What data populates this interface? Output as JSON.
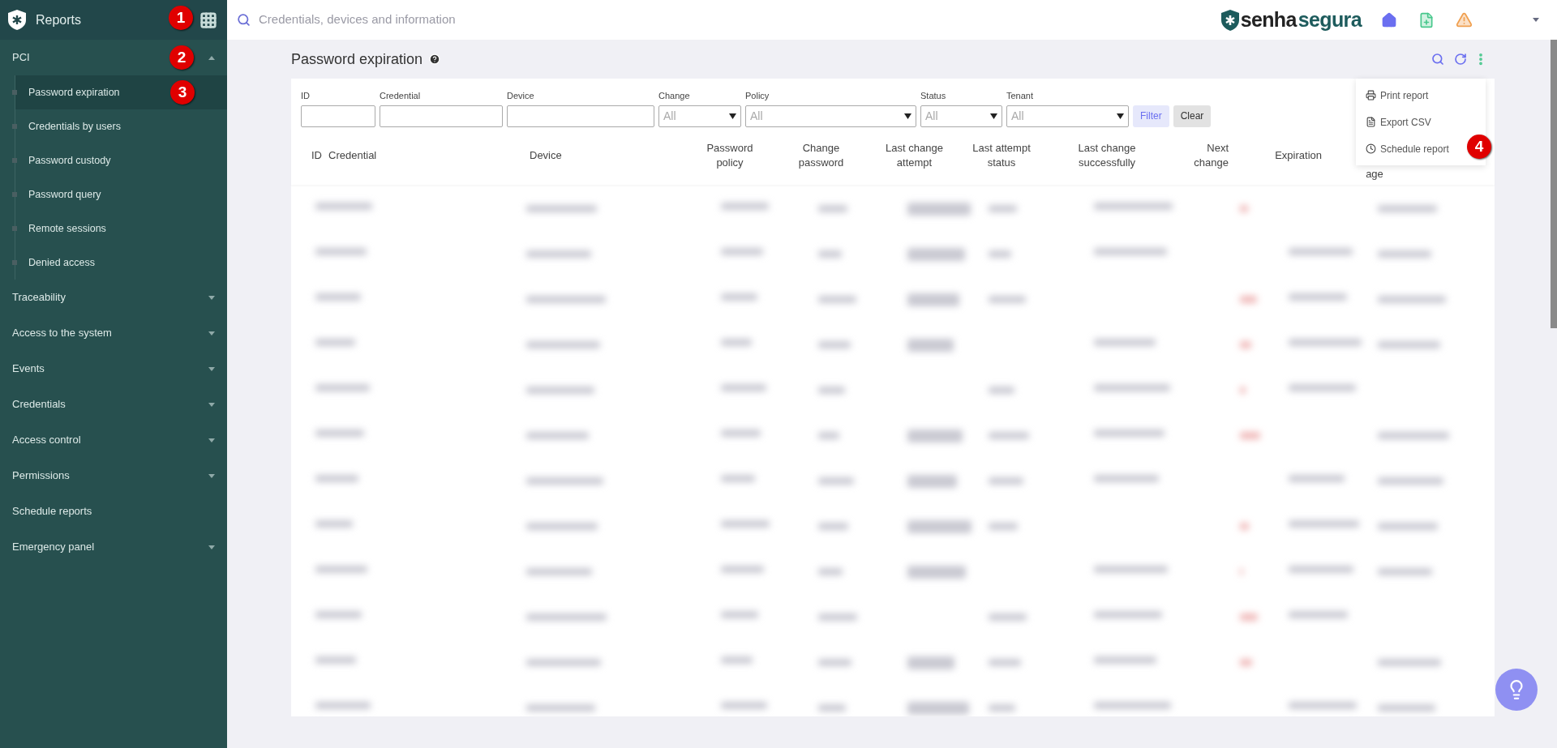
{
  "sidebar": {
    "title": "Reports",
    "callout": "1",
    "sections": [
      {
        "label": "PCI",
        "kind": "group",
        "expanded": true,
        "callout": "2",
        "children": [
          {
            "label": "Password expiration",
            "selected": true,
            "callout": "3"
          },
          {
            "label": "Credentials by users",
            "selected": false
          },
          {
            "label": "Password custody",
            "selected": false
          },
          {
            "label": "Password query",
            "selected": false
          },
          {
            "label": "Remote sessions",
            "selected": false
          },
          {
            "label": "Denied access",
            "selected": false
          }
        ]
      },
      {
        "label": "Traceability",
        "kind": "group",
        "expanded": false
      },
      {
        "label": "Access to the system",
        "kind": "group",
        "expanded": false
      },
      {
        "label": "Events",
        "kind": "group",
        "expanded": false
      },
      {
        "label": "Credentials",
        "kind": "group",
        "expanded": false
      },
      {
        "label": "Access control",
        "kind": "group",
        "expanded": false
      },
      {
        "label": "Permissions",
        "kind": "group",
        "expanded": false
      },
      {
        "label": "Schedule reports",
        "kind": "link"
      },
      {
        "label": "Emergency panel",
        "kind": "group",
        "expanded": false
      }
    ]
  },
  "topbar": {
    "search": {
      "placeholder": "Credentials, devices and information"
    },
    "logo": {
      "part_1": "senha",
      "part_2": "segura"
    }
  },
  "page": {
    "title": "Password expiration"
  },
  "filters": [
    {
      "label": "ID",
      "kind": "text"
    },
    {
      "label": "Credential",
      "kind": "text"
    },
    {
      "label": "Device",
      "kind": "text"
    },
    {
      "label": "Change",
      "kind": "select",
      "value": "All"
    },
    {
      "label": "Policy",
      "kind": "select",
      "value": "All"
    },
    {
      "label": "Status",
      "kind": "select",
      "value": "All"
    },
    {
      "label": "Tenant",
      "kind": "select",
      "value": "All"
    }
  ],
  "filter_buttons": [
    {
      "label": "Filter",
      "kind": "primary"
    },
    {
      "label": "Clear",
      "kind": "secondary"
    }
  ],
  "table": {
    "columns": [
      "ID",
      "Credential",
      "Device",
      "Password policy",
      "Change password",
      "Last change attempt",
      "Last attempt status",
      "Last change successfully",
      "Next change",
      "Expiration",
      "age"
    ]
  },
  "menu": {
    "items": [
      {
        "label": "Print report",
        "kind": "print"
      },
      {
        "label": "Export CSV",
        "kind": "export"
      },
      {
        "label": "Schedule report",
        "kind": "schedule",
        "callout": "4"
      }
    ]
  }
}
